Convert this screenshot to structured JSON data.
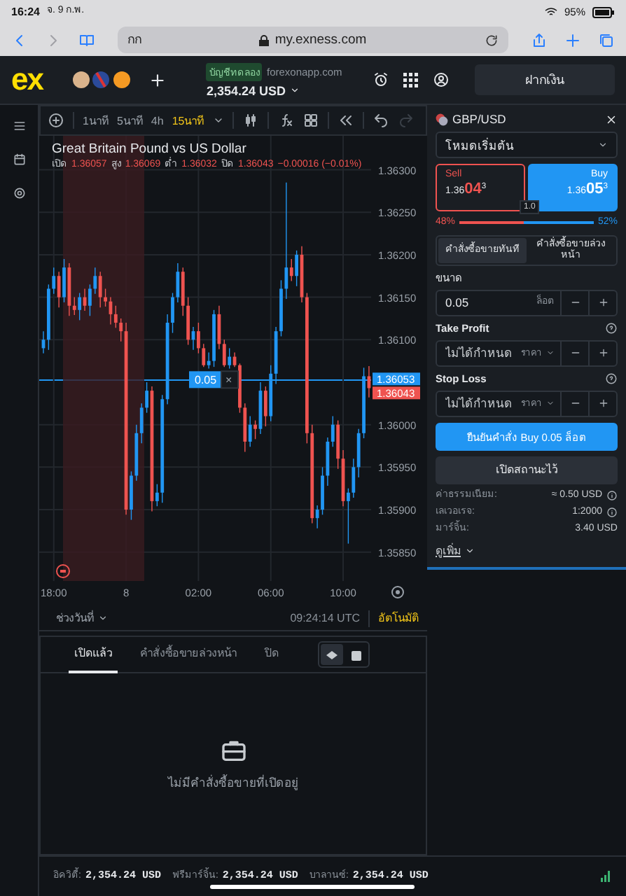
{
  "status_bar": {
    "time": "16:24",
    "date": "จ. 9 ก.พ.",
    "battery": "95%"
  },
  "browser": {
    "tab_text": "กก",
    "url": "my.exness.com"
  },
  "header": {
    "logo": "ex",
    "account_badge": "บัญชีทดลอง",
    "site": "forexonapp.com",
    "balance": "2,354.24 USD",
    "deposit_button": "ฝากเงิน"
  },
  "toolbar": {
    "timeframes": [
      {
        "label": "1นาที",
        "selected": false
      },
      {
        "label": "5นาที",
        "selected": false
      },
      {
        "label": "4h",
        "selected": false
      },
      {
        "label": "15นาที",
        "selected": true
      }
    ]
  },
  "chart": {
    "title": "Great Britain Pound vs US Dollar",
    "ohlc": [
      {
        "label": "เปิด",
        "value": "1.36057"
      },
      {
        "label": "สูง",
        "value": "1.36069"
      },
      {
        "label": "ต่ำ",
        "value": "1.36032"
      },
      {
        "label": "ปิด",
        "value": "1.36043"
      }
    ],
    "change": "−0.00016 (−0.01%)",
    "ask_label": "1.36053",
    "bid_label": "1.36043",
    "order_line": {
      "volume": "0.05",
      "close": "×"
    },
    "range_button": "ช่วงวันที่",
    "clock": "09:24:14 UTC",
    "auto_button": "อัตโนมัติ",
    "chart_data": {
      "type": "candlestick",
      "categories": [
        null,
        null,
        "18:00",
        null,
        null,
        null,
        null,
        null,
        null,
        null,
        null,
        null,
        null,
        null,
        null,
        null,
        "8",
        null,
        null,
        null,
        null,
        null,
        null,
        null,
        null,
        null,
        null,
        null,
        null,
        null,
        "02:00",
        null,
        null,
        null,
        null,
        null,
        null,
        null,
        null,
        null,
        null,
        null,
        null,
        null,
        "06:00",
        null,
        null,
        null,
        null,
        null,
        null,
        null,
        null,
        null,
        null,
        null,
        null,
        null,
        "10:00",
        null,
        null,
        null,
        null,
        null
      ],
      "ylim": [
        1.35816,
        1.3634
      ],
      "grid": true,
      "ohlc": [
        [
          1.3609,
          1.3611,
          1.36084,
          1.361
        ],
        [
          1.361,
          1.36165,
          1.36088,
          1.3616
        ],
        [
          1.3616,
          1.36185,
          1.36154,
          1.36175
        ],
        [
          1.36175,
          1.3618,
          1.36138,
          1.3615
        ],
        [
          1.3615,
          1.36195,
          1.36144,
          1.36185
        ],
        [
          1.36185,
          1.3619,
          1.36128,
          1.3614
        ],
        [
          1.3614,
          1.3615,
          1.36129,
          1.36135
        ],
        [
          1.36135,
          1.36155,
          1.36123,
          1.3615
        ],
        [
          1.3615,
          1.3616,
          1.36134,
          1.3614
        ],
        [
          1.3614,
          1.36165,
          1.36128,
          1.3616
        ],
        [
          1.3616,
          1.36185,
          1.36154,
          1.36175
        ],
        [
          1.36175,
          1.3618,
          1.36138,
          1.3615
        ],
        [
          1.3615,
          1.3616,
          1.36139,
          1.36145
        ],
        [
          1.36145,
          1.3615,
          1.36118,
          1.3613
        ],
        [
          1.3613,
          1.3614,
          1.36114,
          1.3612
        ],
        [
          1.3612,
          1.36125,
          1.36098,
          1.3611
        ],
        [
          1.3611,
          1.3612,
          1.35894,
          1.359
        ],
        [
          1.359,
          1.35945,
          1.35888,
          1.3594
        ],
        [
          1.3594,
          1.36,
          1.35934,
          1.3599
        ],
        [
          1.3599,
          1.36025,
          1.35978,
          1.3602
        ],
        [
          1.3602,
          1.3605,
          1.36014,
          1.3604
        ],
        [
          1.3604,
          1.36045,
          1.35898,
          1.3591
        ],
        [
          1.3591,
          1.3593,
          1.35904,
          1.3592
        ],
        [
          1.3592,
          1.36035,
          1.35908,
          1.3603
        ],
        [
          1.3603,
          1.3613,
          1.36024,
          1.3612
        ],
        [
          1.3612,
          1.36155,
          1.36108,
          1.3615
        ],
        [
          1.3615,
          1.3619,
          1.36144,
          1.3618
        ],
        [
          1.3618,
          1.36185,
          1.36128,
          1.3614
        ],
        [
          1.3614,
          1.3615,
          1.36094,
          1.361
        ],
        [
          1.361,
          1.36115,
          1.36088,
          1.3611
        ],
        [
          1.3611,
          1.3612,
          1.36084,
          1.3609
        ],
        [
          1.3609,
          1.36095,
          1.36068,
          1.3607
        ],
        [
          1.3607,
          1.36085,
          1.36066,
          1.36075
        ],
        [
          1.36075,
          1.36135,
          1.36068,
          1.3613
        ],
        [
          1.3613,
          1.3614,
          1.36089,
          1.36095
        ],
        [
          1.36095,
          1.361,
          1.36068,
          1.3607
        ],
        [
          1.3607,
          1.3609,
          1.36066,
          1.3608
        ],
        [
          1.3608,
          1.36085,
          1.36068,
          1.3607
        ],
        [
          1.3607,
          1.36072,
          1.36014,
          1.3602
        ],
        [
          1.3602,
          1.36025,
          1.35968,
          1.3598
        ],
        [
          1.3598,
          1.3601,
          1.35974,
          1.36
        ],
        [
          1.36,
          1.36005,
          1.35983,
          1.35995
        ],
        [
          1.35995,
          1.3605,
          1.35989,
          1.3604
        ],
        [
          1.3604,
          1.36045,
          1.35998,
          1.3601
        ],
        [
          1.3601,
          1.3607,
          1.36004,
          1.3606
        ],
        [
          1.3606,
          1.36115,
          1.36048,
          1.3611
        ],
        [
          1.3611,
          1.3617,
          1.36104,
          1.3616
        ],
        [
          1.3616,
          1.36285,
          1.36148,
          1.36185
        ],
        [
          1.36185,
          1.36195,
          1.36169,
          1.36175
        ],
        [
          1.36175,
          1.36205,
          1.36163,
          1.362
        ],
        [
          1.362,
          1.3621,
          1.36144,
          1.3615
        ],
        [
          1.3615,
          1.36155,
          1.35978,
          1.3599
        ],
        [
          1.3599,
          1.36,
          1.35884,
          1.3589
        ],
        [
          1.3589,
          1.35905,
          1.35878,
          1.359
        ],
        [
          1.359,
          1.3595,
          1.35894,
          1.3594
        ],
        [
          1.3594,
          1.35985,
          1.35928,
          1.3598
        ],
        [
          1.3598,
          1.3601,
          1.35974,
          1.36
        ],
        [
          1.36,
          1.36005,
          1.35948,
          1.3596
        ],
        [
          1.3596,
          1.3597,
          1.35904,
          1.3591
        ],
        [
          1.3591,
          1.35925,
          1.3586,
          1.3592
        ],
        [
          1.3592,
          1.3596,
          1.35914,
          1.3595
        ],
        [
          1.3595,
          1.35995,
          1.35938,
          1.3599
        ],
        [
          1.3599,
          1.36067,
          1.35984,
          1.36057
        ],
        [
          1.36057,
          1.36069,
          1.36032,
          1.36043
        ]
      ],
      "yticks": [
        {
          "value": 1.363,
          "label": "1.36300"
        },
        {
          "value": 1.3625,
          "label": "1.36250"
        },
        {
          "value": 1.362,
          "label": "1.36200"
        },
        {
          "value": 1.3615,
          "label": "1.36150"
        },
        {
          "value": 1.361,
          "label": "1.36100"
        },
        {
          "value": 1.36,
          "label": "1.36000"
        },
        {
          "value": 1.3595,
          "label": "1.35950"
        },
        {
          "value": 1.359,
          "label": "1.35900"
        },
        {
          "value": 1.3585,
          "label": "1.35850"
        }
      ]
    }
  },
  "bottom_panel": {
    "tabs": [
      {
        "label": "เปิดแล้ว",
        "selected": true
      },
      {
        "label": "คำสั่งซื้อขายล่วงหน้า",
        "selected": false
      },
      {
        "label": "ปิด",
        "selected": false
      }
    ],
    "view_toggle": [
      {
        "selected": true
      },
      {
        "selected": false
      }
    ],
    "empty_text": "ไม่มีคำสั่งซื้อขายที่เปิดอยู่"
  },
  "footer": [
    {
      "label": "อิควิตี้:",
      "value": "2,354.24 USD"
    },
    {
      "label": "ฟรีมาร์จิ้น:",
      "value": "2,354.24 USD"
    },
    {
      "label": "บาลานซ์:",
      "value": "2,354.24 USD"
    }
  ],
  "order_panel": {
    "symbol": "GBP/USD",
    "mode": "โหมดเริ่มต้น",
    "sides": [
      {
        "kind": "sell",
        "label": "Sell",
        "price_head": "1.36",
        "price_big": "04",
        "price_tail": "3",
        "selected": false
      },
      {
        "kind": "buy",
        "label": "Buy",
        "price_head": "1.36",
        "price_big": "05",
        "price_tail": "3",
        "selected": true
      }
    ],
    "spread": "1.0",
    "sentiment": {
      "sell": "48%",
      "buy": "52%",
      "level": 0.48
    },
    "order_types": [
      {
        "label": "คำสั่งซื้อขายทันที",
        "selected": true
      },
      {
        "label": "คำสั่งซื้อขายล่วงหน้า",
        "selected": false
      }
    ],
    "volume": {
      "label": "ขนาด",
      "value": "0.05",
      "unit": "ล็อต"
    },
    "take_profit": {
      "label": "Take Profit",
      "placeholder": "ไม่ได้กำหนด",
      "unit": "ราคา"
    },
    "stop_loss": {
      "label": "Stop Loss",
      "placeholder": "ไม่ได้กำหนด",
      "unit": "ราคา"
    },
    "confirm_button": "ยืนยันคำสั่ง Buy 0.05 ล็อต",
    "cancel_button": "เปิดสถานะไว้",
    "details": [
      {
        "label": "ค่าธรรมเนียม:",
        "value": "≈ 0.50 USD",
        "info": true
      },
      {
        "label": "เลเวอเรจ:",
        "value": "1:2000",
        "info": true
      },
      {
        "label": "มาร์จิ้น:",
        "value": "3.40 USD",
        "info": false
      }
    ],
    "more": "ดูเพิ่ม"
  }
}
